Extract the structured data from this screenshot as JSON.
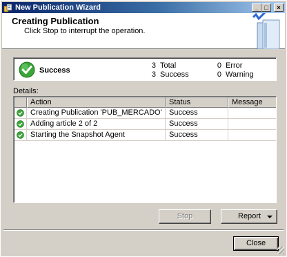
{
  "window": {
    "title": "New Publication Wizard",
    "controls": {
      "minimize": "_",
      "maximize": "□",
      "close": "×"
    }
  },
  "header": {
    "title": "Creating Publication",
    "subtitle": "Click Stop to interrupt the operation."
  },
  "summary": {
    "status": "Success",
    "total_count": "3",
    "total_label": "Total",
    "success_count": "3",
    "success_label": "Success",
    "error_count": "0",
    "error_label": "Error",
    "warning_count": "0",
    "warning_label": "Warning"
  },
  "details": {
    "label": "Details:",
    "columns": [
      "Action",
      "Status",
      "Message"
    ],
    "rows": [
      {
        "action": "Creating Publication 'PUB_MERCADO'",
        "status": "Success",
        "message": ""
      },
      {
        "action": "Adding article 2 of 2",
        "status": "Success",
        "message": ""
      },
      {
        "action": "Starting the Snapshot Agent",
        "status": "Success",
        "message": ""
      }
    ]
  },
  "buttons": {
    "stop": "Stop",
    "report": "Report",
    "close": "Close"
  },
  "icons": {
    "success": "success-check-icon",
    "app": "wizard-app-icon",
    "header_art": "book-header-icon"
  },
  "colors": {
    "success_green": "#3aa63a",
    "titlebar_start": "#0a246a",
    "titlebar_end": "#a6caf0"
  }
}
